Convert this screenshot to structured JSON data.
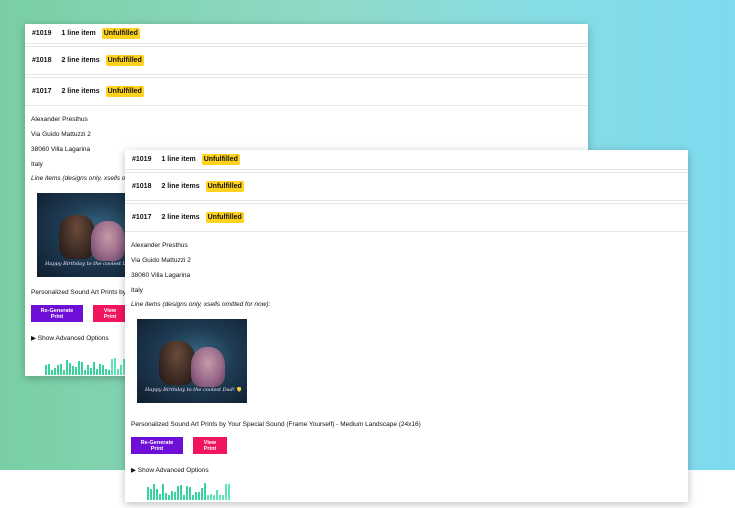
{
  "orders": [
    {
      "number": "#1019",
      "line_items": "1 line item",
      "status": "Unfulfilled"
    },
    {
      "number": "#1018",
      "line_items": "2 line items",
      "status": "Unfulfilled"
    },
    {
      "number": "#1017",
      "line_items": "2 line items",
      "status": "Unfulfilled"
    }
  ],
  "detail": {
    "name": "Alexander Presthus",
    "street": "Via Guido Mattuzzi 2",
    "city": "38060 Villa Lagarina",
    "country": "Italy",
    "line_items_note": "Line items (designs only, xsells omitted for now):",
    "back_line_items_note": "Line items (designs only, xsells omitted",
    "image_caption": "Happy Birthday to the coolest Dad! 💛",
    "product_title": "Personalized Sound Art Prints by Your Special Sound (Frame Yourself) - Medium Landscape (24x16)",
    "back_product_title": "Personalized Sound Art Prints by Yo",
    "regenerate_label": "Re-Generate Print",
    "view_label": "View Print",
    "advanced_label": "▶ Show Advanced Options"
  },
  "colors": {
    "badge": "#ffd21f",
    "regenerate": "#6d0fd6",
    "view": "#f0155d",
    "waveform": "#38d39a"
  }
}
